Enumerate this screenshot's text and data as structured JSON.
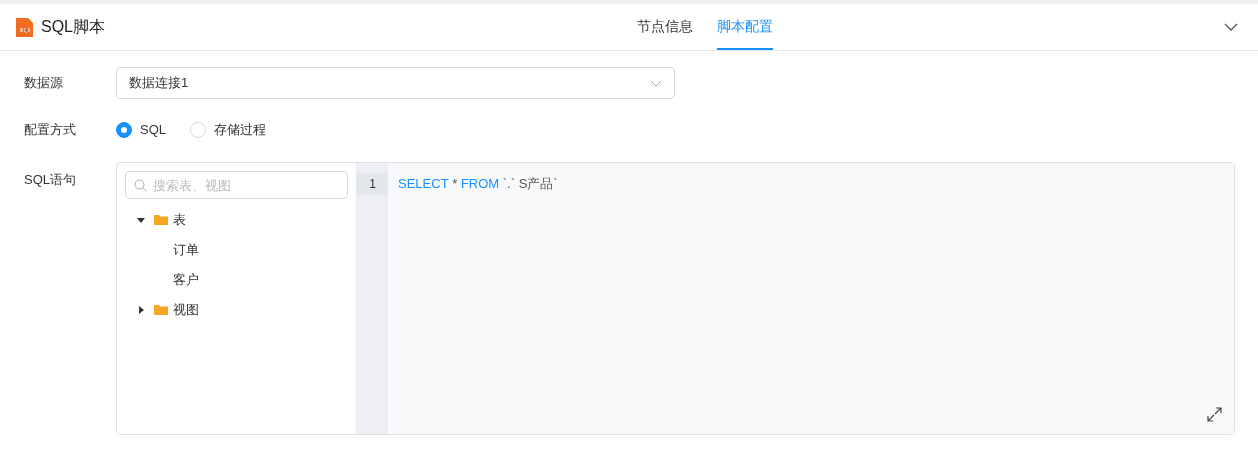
{
  "header": {
    "title": "SQL脚本",
    "tabs": [
      {
        "label": "节点信息",
        "selected": false
      },
      {
        "label": "脚本配置",
        "selected": true
      }
    ]
  },
  "form": {
    "datasource": {
      "label": "数据源",
      "value": "数据连接1"
    },
    "mode": {
      "label": "配置方式",
      "options": [
        {
          "label": "SQL",
          "selected": true
        },
        {
          "label": "存储过程",
          "selected": false
        }
      ]
    },
    "sql": {
      "label": "SQL语句",
      "search": {
        "placeholder": "搜索表、视图"
      },
      "tree": [
        {
          "label": "表",
          "expanded": true,
          "children": [
            {
              "label": "订单"
            },
            {
              "label": "客户"
            }
          ]
        },
        {
          "label": "视图",
          "expanded": false
        }
      ],
      "editor": {
        "lines": [
          {
            "number": "1",
            "tokens": [
              {
                "text": "SELECT",
                "kind": "keyword"
              },
              {
                "text": " * ",
                "kind": "plain"
              },
              {
                "text": "FROM",
                "kind": "keyword"
              },
              {
                "text": " `.` S产品`",
                "kind": "plain"
              }
            ]
          }
        ]
      }
    }
  }
}
